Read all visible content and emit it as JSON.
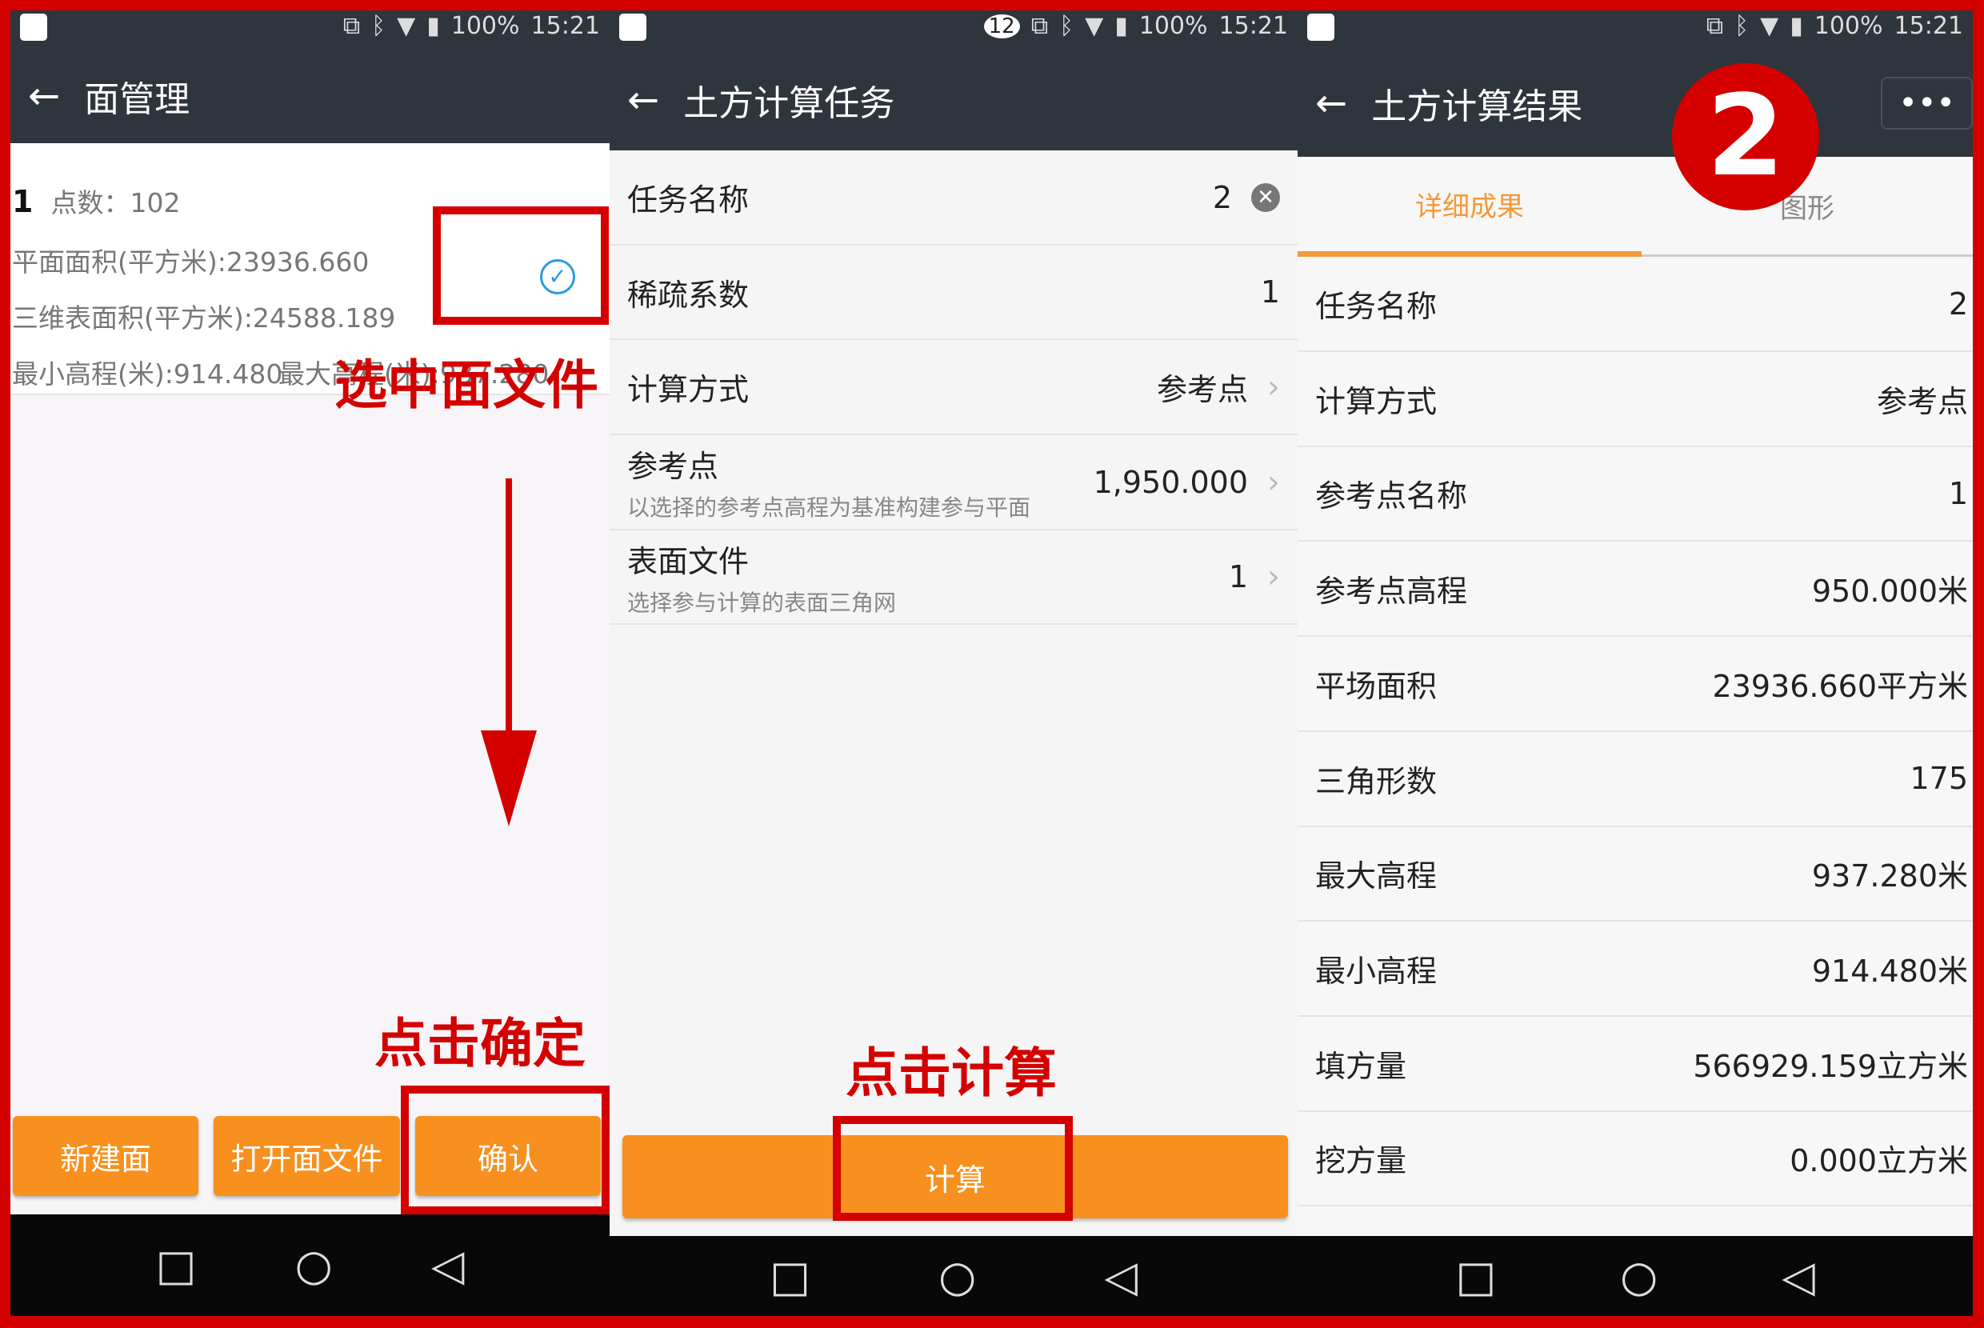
{
  "status": {
    "battery": "100%",
    "time": "15:21",
    "notif_count": "12"
  },
  "panel1": {
    "title": "面管理",
    "item": {
      "index": "1",
      "points": "点数：102",
      "plane_area": "平面面积(平方米):23936.660",
      "surface_area": "三维表面积(平方米):24588.189",
      "min_elev": "最小高程(米):914.480",
      "max_elev": "最大高程(米):937.280"
    },
    "buttons": {
      "new": "新建面",
      "open": "打开面文件",
      "confirm": "确认"
    },
    "annotations": {
      "select": "选中面文件",
      "confirm": "点击确定"
    }
  },
  "panel2": {
    "title": "土方计算任务",
    "rows": [
      {
        "label": "任务名称",
        "value": "2",
        "sub": ""
      },
      {
        "label": "稀疏系数",
        "value": "1",
        "sub": ""
      },
      {
        "label": "计算方式",
        "value": "参考点",
        "sub": ""
      },
      {
        "label": "参考点",
        "value": "1,950.000",
        "sub": "以选择的参考点高程为基准构建参与平面"
      },
      {
        "label": "表面文件",
        "value": "1",
        "sub": "选择参与计算的表面三角网"
      }
    ],
    "calc_button": "计算",
    "annotation": "点击计算"
  },
  "panel3": {
    "title": "土方计算结果",
    "tabs": [
      "详细成果",
      "图形"
    ],
    "active_tab": 0,
    "badge": "2",
    "rows": [
      {
        "label": "任务名称",
        "value": "2"
      },
      {
        "label": "计算方式",
        "value": "参考点"
      },
      {
        "label": "参考点名称",
        "value": "1"
      },
      {
        "label": "参考点高程",
        "value": "950.000米"
      },
      {
        "label": "平场面积",
        "value": "23936.660平方米"
      },
      {
        "label": "三角形数",
        "value": "175"
      },
      {
        "label": "最大高程",
        "value": "937.280米"
      },
      {
        "label": "最小高程",
        "value": "914.480米"
      },
      {
        "label": "填方量",
        "value": "566929.159立方米"
      },
      {
        "label": "挖方量",
        "value": "0.000立方米"
      }
    ]
  },
  "colors": {
    "accent": "#f7901e",
    "annotation": "#d40000",
    "header": "#2f353c"
  }
}
